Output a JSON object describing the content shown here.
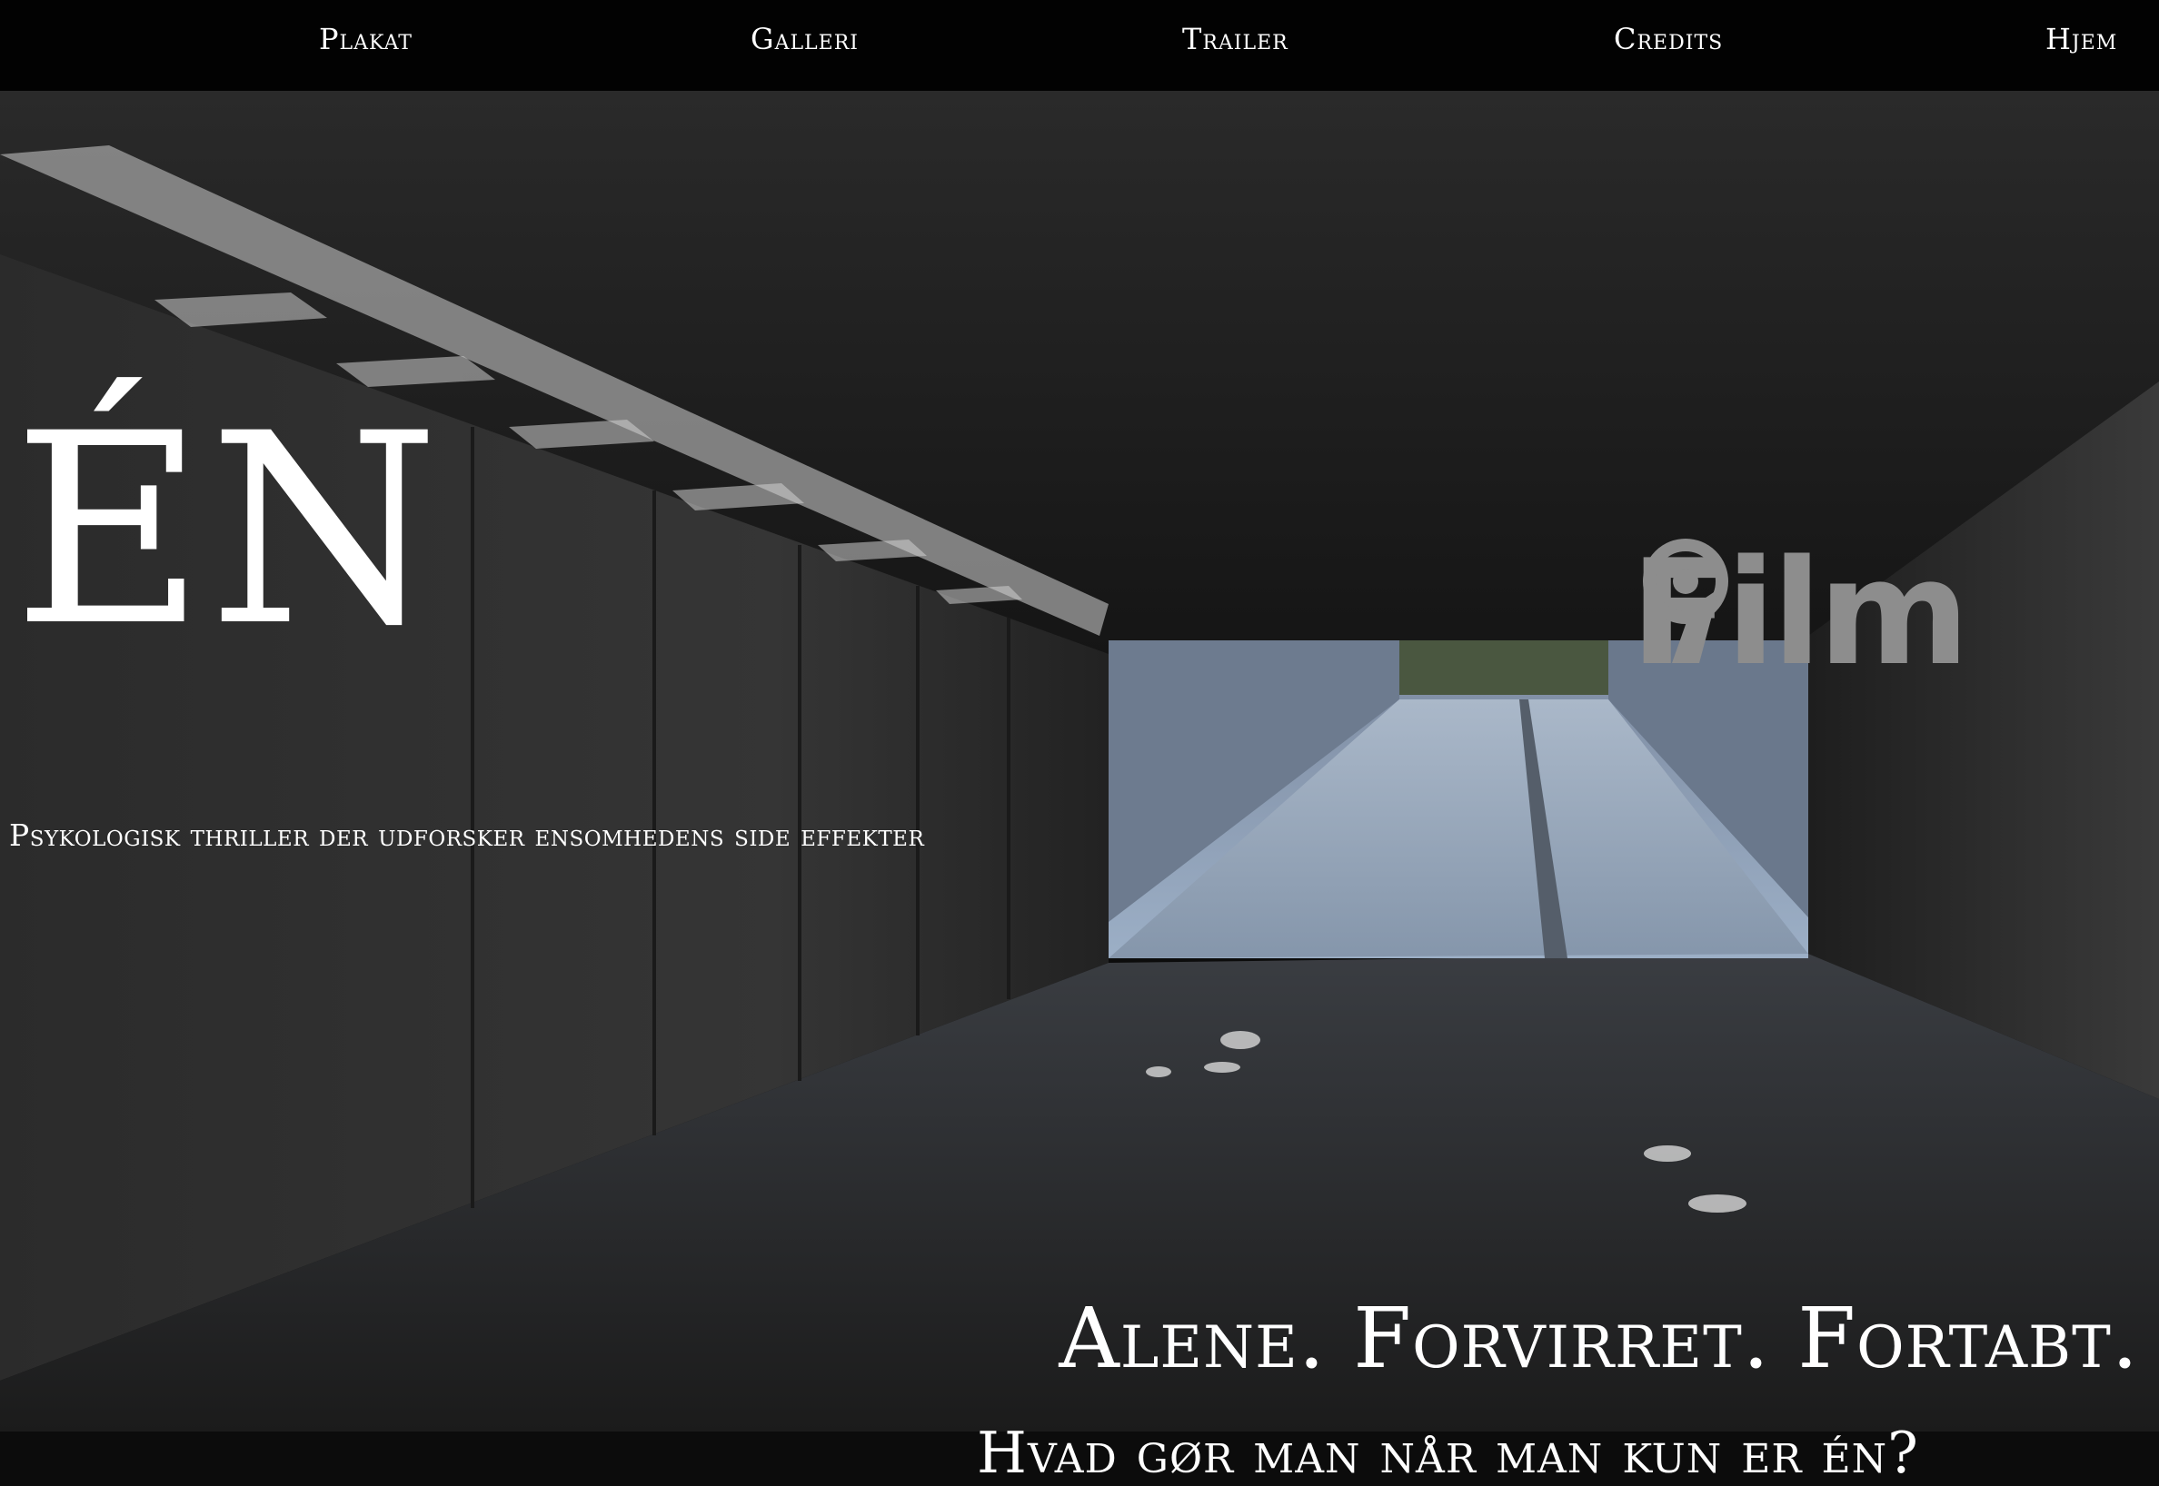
{
  "nav": {
    "items": [
      {
        "label": "Plakat"
      },
      {
        "label": "Galleri"
      },
      {
        "label": "Trailer"
      },
      {
        "label": "Credits"
      },
      {
        "label": "Hjem"
      }
    ]
  },
  "hero": {
    "title": "ÉN",
    "tagline": "Psykologisk thriller der udforsker ensomhedens side effekter",
    "logo_text": "Film",
    "logo_icon": "film-reel-nine-icon",
    "headline": "Alene. Forvirret. Fortabt.",
    "question": "Hvad gør man når man kun er én?"
  },
  "colors": {
    "nav_background": "#020202",
    "text": "#ffffff",
    "logo": "#8d8d8d",
    "tunnel_exit": "#8fa1b8"
  }
}
